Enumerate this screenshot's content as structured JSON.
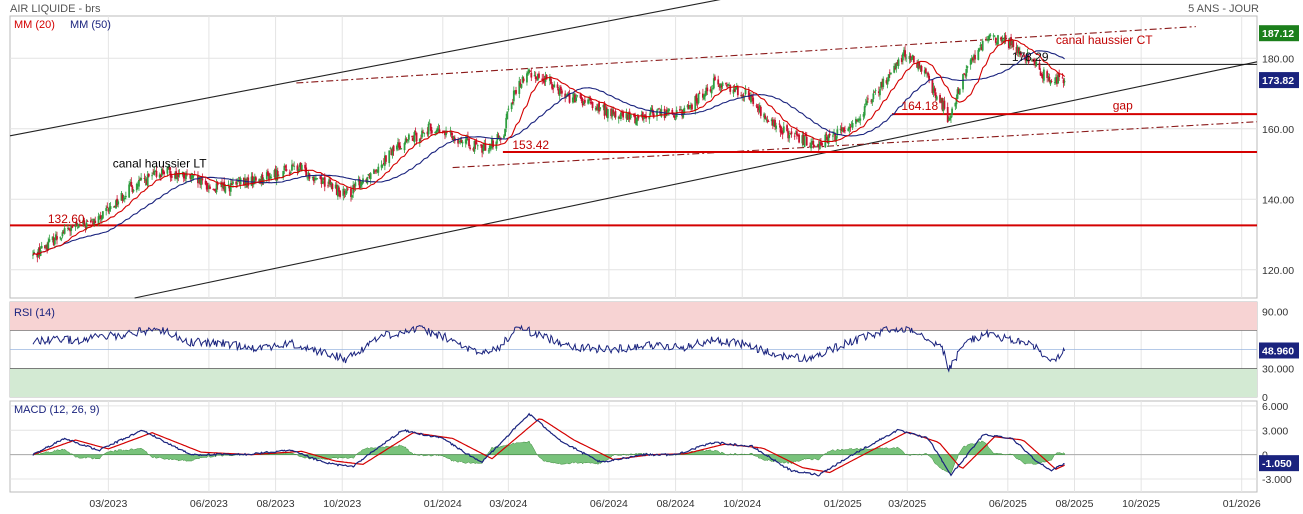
{
  "header": {
    "title": "AIR LIQUIDE - brs",
    "period": "5 ANS - JOUR",
    "ma20_label": "MM (20)",
    "ma50_label": "MM (50)"
  },
  "colors": {
    "price_up": "#2e9e3f",
    "price_down": "#c8102e",
    "ma20": "#d40000",
    "ma50": "#1a237e",
    "support_line": "#d40000",
    "channel_lt": "#222222",
    "channel_ct": "#8b1a1a",
    "rsi_line": "#1a237e",
    "rsi_overbought_zone": "#f7d3d3",
    "rsi_oversold_zone": "#d3ead3",
    "macd_line": "#1a237e",
    "signal_line": "#d40000",
    "histogram": "#4caf50",
    "last_price_badge": "#1a237e",
    "high_badge": "#1b7f1b"
  },
  "chart_data": [
    {
      "type": "candlestick",
      "panel": "price",
      "x_start": "2022-12-22",
      "x_end": "2025-07-23",
      "x_axis_range": [
        "2022-12-01",
        "2026-01-15"
      ],
      "ylim": [
        112,
        192
      ],
      "y_ticks": [
        120,
        140,
        160,
        180
      ],
      "x_tick_labels": [
        {
          "date": "2023-03-01",
          "label": "03/2023"
        },
        {
          "date": "2023-06-01",
          "label": "06/2023"
        },
        {
          "date": "2023-08-01",
          "label": "08/2023"
        },
        {
          "date": "2023-10-01",
          "label": "10/2023"
        },
        {
          "date": "2024-01-01",
          "label": "01/2024"
        },
        {
          "date": "2024-03-01",
          "label": "03/2024"
        },
        {
          "date": "2024-06-01",
          "label": "06/2024"
        },
        {
          "date": "2024-08-01",
          "label": "08/2024"
        },
        {
          "date": "2024-10-01",
          "label": "10/2024"
        },
        {
          "date": "2025-01-01",
          "label": "01/2025"
        },
        {
          "date": "2025-03-01",
          "label": "03/2025"
        },
        {
          "date": "2025-06-01",
          "label": "06/2025"
        },
        {
          "date": "2025-08-01",
          "label": "08/2025"
        },
        {
          "date": "2025-10-01",
          "label": "10/2025"
        },
        {
          "date": "2026-01-01",
          "label": "01/2026"
        }
      ],
      "price_path": [
        [
          "2022-12-22",
          124
        ],
        [
          "2023-01-20",
          131
        ],
        [
          "2023-02-20",
          134
        ],
        [
          "2023-03-20",
          143
        ],
        [
          "2023-04-20",
          148
        ],
        [
          "2023-05-15",
          146
        ],
        [
          "2023-06-05",
          143
        ],
        [
          "2023-06-25",
          144
        ],
        [
          "2023-07-20",
          146
        ],
        [
          "2023-08-20",
          149
        ],
        [
          "2023-09-10",
          146
        ],
        [
          "2023-10-05",
          141
        ],
        [
          "2023-10-25",
          147
        ],
        [
          "2023-11-20",
          155
        ],
        [
          "2023-12-20",
          160
        ],
        [
          "2024-01-10",
          158
        ],
        [
          "2024-01-25",
          156
        ],
        [
          "2024-02-05",
          154
        ],
        [
          "2024-02-25",
          158
        ],
        [
          "2024-03-01",
          166
        ],
        [
          "2024-03-10",
          172
        ],
        [
          "2024-03-20",
          176
        ],
        [
          "2024-04-10",
          173
        ],
        [
          "2024-04-25",
          169
        ],
        [
          "2024-05-15",
          167
        ],
        [
          "2024-06-05",
          164
        ],
        [
          "2024-06-25",
          163
        ],
        [
          "2024-07-15",
          165
        ],
        [
          "2024-08-05",
          164
        ],
        [
          "2024-08-20",
          168
        ],
        [
          "2024-09-05",
          173
        ],
        [
          "2024-09-20",
          172
        ],
        [
          "2024-10-05",
          170
        ],
        [
          "2024-10-25",
          162
        ],
        [
          "2024-11-20",
          157
        ],
        [
          "2024-12-10",
          156
        ],
        [
          "2024-12-25",
          158
        ],
        [
          "2025-01-15",
          163
        ],
        [
          "2025-02-05",
          172
        ],
        [
          "2025-02-25",
          181
        ],
        [
          "2025-03-05",
          180
        ],
        [
          "2025-03-20",
          174
        ],
        [
          "2025-04-03",
          166
        ],
        [
          "2025-04-08",
          162
        ],
        [
          "2025-04-20",
          174
        ],
        [
          "2025-05-05",
          183
        ],
        [
          "2025-05-20",
          186
        ],
        [
          "2025-06-05",
          184
        ],
        [
          "2025-06-20",
          180
        ],
        [
          "2025-07-05",
          175
        ],
        [
          "2025-07-23",
          173.82
        ]
      ],
      "series_labels": [
        "MM (20)",
        "MM (50)"
      ],
      "last_price": 173.82,
      "high_marker": 187.12,
      "price_labels": [
        {
          "text": "132.60",
          "date": "2023-01-01",
          "value": 133
        },
        {
          "text": "153.42",
          "date": "2024-03-01",
          "value": 154
        },
        {
          "text": "164.18",
          "date": "2025-02-20",
          "value": 165
        },
        {
          "text": "178.29",
          "date": "2025-06-01",
          "value": 179
        }
      ],
      "horizontal_lines": [
        {
          "value": 132.6,
          "from": "2022-12-01",
          "to": "2026-01-15",
          "color": "#d40000"
        },
        {
          "value": 153.42,
          "from": "2024-02-25",
          "to": "2026-01-15",
          "color": "#d40000"
        },
        {
          "value": 164.18,
          "from": "2025-02-15",
          "to": "2026-01-15",
          "color": "#d40000"
        },
        {
          "value": 178.29,
          "from": "2025-05-25",
          "to": "2026-01-15",
          "color": "#111111"
        }
      ],
      "trend_lines": [
        {
          "name": "canal haussier LT (haut)",
          "from": [
            "2022-12-01",
            158
          ],
          "to": [
            "2024-10-20",
            199
          ],
          "style": "solid",
          "color": "#222222"
        },
        {
          "name": "canal haussier LT (bas)",
          "from": [
            "2023-03-25",
            112
          ],
          "to": [
            "2026-01-15",
            179
          ],
          "style": "solid",
          "color": "#222222"
        },
        {
          "name": "canal haussier CT (haut)",
          "from": [
            "2023-08-20",
            173
          ],
          "to": [
            "2025-11-20",
            189
          ],
          "style": "dashdot",
          "color": "#8b1a1a"
        },
        {
          "name": "canal haussier CT (bas)",
          "from": [
            "2024-01-10",
            149
          ],
          "to": [
            "2026-01-15",
            162
          ],
          "style": "dashdot",
          "color": "#8b1a1a"
        }
      ],
      "annotations": [
        {
          "text": "canal haussier LT",
          "date": "2023-03-05",
          "value": 149,
          "color": "#000000"
        },
        {
          "text": "canal haussier CT",
          "date": "2025-07-15",
          "value": 184,
          "color": "#c00000"
        },
        {
          "text": "gap",
          "date": "2025-09-05",
          "value": 165.5,
          "color": "#c00000"
        }
      ]
    },
    {
      "type": "line",
      "panel": "rsi",
      "label": "RSI (14)",
      "ylim": [
        0,
        100
      ],
      "y_ticks": [
        0,
        30,
        90
      ],
      "overbought": 70,
      "oversold": 30,
      "midline": 50,
      "path": [
        [
          "2022-12-22",
          60
        ],
        [
          "2023-02-01",
          60
        ],
        [
          "2023-03-15",
          66
        ],
        [
          "2023-04-15",
          72
        ],
        [
          "2023-05-15",
          58
        ],
        [
          "2023-06-15",
          56
        ],
        [
          "2023-07-15",
          52
        ],
        [
          "2023-08-15",
          56
        ],
        [
          "2023-09-15",
          46
        ],
        [
          "2023-10-05",
          40
        ],
        [
          "2023-11-05",
          64
        ],
        [
          "2023-12-10",
          72
        ],
        [
          "2024-01-05",
          62
        ],
        [
          "2024-02-01",
          46
        ],
        [
          "2024-02-20",
          50
        ],
        [
          "2024-03-10",
          74
        ],
        [
          "2024-04-05",
          62
        ],
        [
          "2024-05-05",
          52
        ],
        [
          "2024-06-05",
          50
        ],
        [
          "2024-07-05",
          55
        ],
        [
          "2024-08-05",
          52
        ],
        [
          "2024-09-05",
          60
        ],
        [
          "2024-10-01",
          56
        ],
        [
          "2024-11-01",
          44
        ],
        [
          "2024-12-01",
          40
        ],
        [
          "2025-01-01",
          55
        ],
        [
          "2025-02-10",
          70
        ],
        [
          "2025-03-05",
          72
        ],
        [
          "2025-04-01",
          54
        ],
        [
          "2025-04-08",
          30
        ],
        [
          "2025-04-25",
          60
        ],
        [
          "2025-05-15",
          66
        ],
        [
          "2025-06-05",
          60
        ],
        [
          "2025-06-25",
          54
        ],
        [
          "2025-07-05",
          40
        ],
        [
          "2025-07-15",
          38
        ],
        [
          "2025-07-23",
          48.96
        ]
      ],
      "last_value": 48.96
    },
    {
      "type": "line",
      "panel": "macd",
      "label": "MACD (12, 26, 9)",
      "ylim": [
        -4.6,
        6.6
      ],
      "y_ticks": [
        -3,
        0,
        3,
        6
      ],
      "macd_path": [
        [
          "2022-12-22",
          0
        ],
        [
          "2023-01-20",
          2
        ],
        [
          "2023-02-20",
          0.5
        ],
        [
          "2023-04-01",
          3
        ],
        [
          "2023-05-15",
          0
        ],
        [
          "2023-07-01",
          0
        ],
        [
          "2023-08-15",
          0.5
        ],
        [
          "2023-09-15",
          -1
        ],
        [
          "2023-10-10",
          -1.5
        ],
        [
          "2023-11-25",
          3
        ],
        [
          "2024-01-01",
          2
        ],
        [
          "2024-02-05",
          -1
        ],
        [
          "2024-03-20",
          5
        ],
        [
          "2024-04-20",
          1.5
        ],
        [
          "2024-05-25",
          -1
        ],
        [
          "2024-07-01",
          0
        ],
        [
          "2024-08-01",
          0
        ],
        [
          "2024-09-05",
          1.5
        ],
        [
          "2024-10-10",
          1
        ],
        [
          "2024-11-15",
          -2
        ],
        [
          "2024-12-10",
          -2.5
        ],
        [
          "2025-01-10",
          0
        ],
        [
          "2025-02-20",
          3
        ],
        [
          "2025-03-20",
          2
        ],
        [
          "2025-04-10",
          -2.5
        ],
        [
          "2025-05-10",
          2.5
        ],
        [
          "2025-06-05",
          2
        ],
        [
          "2025-06-25",
          -0.5
        ],
        [
          "2025-07-10",
          -2
        ],
        [
          "2025-07-23",
          -1.05
        ]
      ],
      "signal_path": [
        [
          "2022-12-22",
          0
        ],
        [
          "2023-01-30",
          1.8
        ],
        [
          "2023-03-01",
          0.7
        ],
        [
          "2023-04-10",
          2.7
        ],
        [
          "2023-05-25",
          0.3
        ],
        [
          "2023-07-10",
          0
        ],
        [
          "2023-08-25",
          0.4
        ],
        [
          "2023-09-25",
          -0.8
        ],
        [
          "2023-10-20",
          -1.2
        ],
        [
          "2023-12-05",
          2.7
        ],
        [
          "2024-01-10",
          2
        ],
        [
          "2024-02-15",
          -0.5
        ],
        [
          "2024-03-30",
          4.5
        ],
        [
          "2024-04-30",
          1.8
        ],
        [
          "2024-06-05",
          -0.6
        ],
        [
          "2024-07-10",
          0
        ],
        [
          "2024-08-10",
          0.1
        ],
        [
          "2024-09-15",
          1.3
        ],
        [
          "2024-10-20",
          0.8
        ],
        [
          "2024-11-25",
          -1.6
        ],
        [
          "2024-12-20",
          -2.2
        ],
        [
          "2025-01-20",
          0
        ],
        [
          "2025-03-01",
          2.8
        ],
        [
          "2025-03-30",
          1.5
        ],
        [
          "2025-04-20",
          -1.8
        ],
        [
          "2025-05-20",
          2.2
        ],
        [
          "2025-06-15",
          1.8
        ],
        [
          "2025-07-05",
          -0.6
        ],
        [
          "2025-07-15",
          -1.8
        ],
        [
          "2025-07-23",
          -1.3
        ]
      ],
      "last_value": -1.05
    }
  ],
  "labels": {
    "rsi_last": "48.960",
    "macd_last": "-1.050",
    "price_last": "173.82",
    "price_high": "187.12",
    "rsi_ticks": [
      "90.00",
      "30.000",
      "0"
    ],
    "macd_ticks": [
      "6.000",
      "3.000",
      "0",
      "-3.000"
    ],
    "price_ticks": [
      "180.00",
      "160.00",
      "140.00",
      "120.00"
    ]
  }
}
